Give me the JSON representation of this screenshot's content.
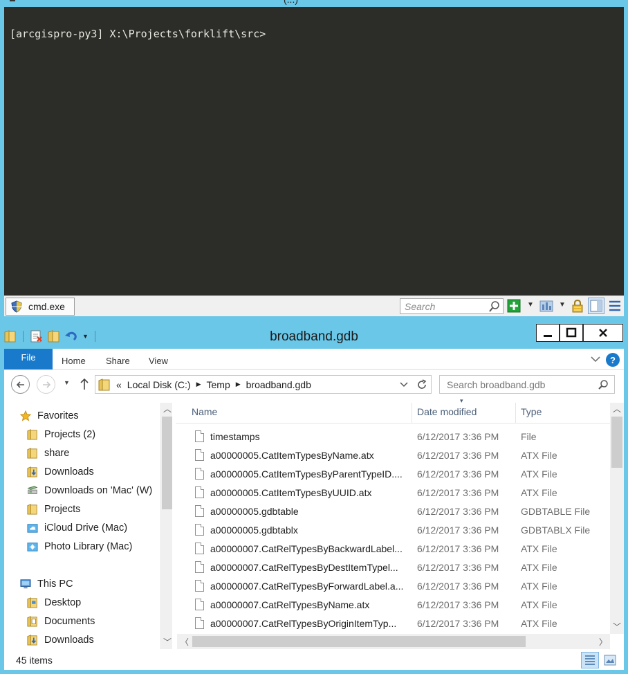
{
  "console": {
    "window_title": "(...)",
    "prompt": "[arcgispro-py3] X:\\Projects\\forklift\\src>",
    "tab_label": "cmd.exe",
    "search_placeholder": "Search"
  },
  "explorer": {
    "title": "broadband.gdb",
    "ribbon_tabs": [
      "File",
      "Home",
      "Share",
      "View"
    ],
    "help_label": "?",
    "address": {
      "overflow": "«",
      "segments": [
        "Local Disk (C:)",
        "Temp",
        "broadband.gdb"
      ]
    },
    "search_placeholder": "Search broadband.gdb",
    "nav": {
      "favorites_label": "Favorites",
      "favorites": [
        "Projects (2)",
        "share",
        "Downloads",
        "Downloads on 'Mac' (W)",
        "Projects",
        "iCloud Drive (Mac)",
        "Photo Library (Mac)"
      ],
      "this_pc_label": "This PC",
      "this_pc": [
        "Desktop",
        "Documents",
        "Downloads"
      ]
    },
    "columns": {
      "name": "Name",
      "date": "Date modified",
      "type": "Type"
    },
    "files": [
      {
        "name": "timestamps",
        "date": "6/12/2017 3:36 PM",
        "type": "File"
      },
      {
        "name": "a00000005.CatItemTypesByName.atx",
        "date": "6/12/2017 3:36 PM",
        "type": "ATX File"
      },
      {
        "name": "a00000005.CatItemTypesByParentTypeID....",
        "date": "6/12/2017 3:36 PM",
        "type": "ATX File"
      },
      {
        "name": "a00000005.CatItemTypesByUUID.atx",
        "date": "6/12/2017 3:36 PM",
        "type": "ATX File"
      },
      {
        "name": "a00000005.gdbtable",
        "date": "6/12/2017 3:36 PM",
        "type": "GDBTABLE File"
      },
      {
        "name": "a00000005.gdbtablx",
        "date": "6/12/2017 3:36 PM",
        "type": "GDBTABLX File"
      },
      {
        "name": "a00000007.CatRelTypesByBackwardLabel...",
        "date": "6/12/2017 3:36 PM",
        "type": "ATX File"
      },
      {
        "name": "a00000007.CatRelTypesByDestItemTypel...",
        "date": "6/12/2017 3:36 PM",
        "type": "ATX File"
      },
      {
        "name": "a00000007.CatRelTypesByForwardLabel.a...",
        "date": "6/12/2017 3:36 PM",
        "type": "ATX File"
      },
      {
        "name": "a00000007.CatRelTypesByName.atx",
        "date": "6/12/2017 3:36 PM",
        "type": "ATX File"
      },
      {
        "name": "a00000007.CatRelTypesByOriginItemTyp...",
        "date": "6/12/2017 3:36 PM",
        "type": "ATX File"
      }
    ],
    "status": "45 items"
  },
  "colors": {
    "frame": "#6bc7e8",
    "console_bg": "#2c2c28",
    "file_tab": "#1979ca",
    "header_text": "#4c607a"
  }
}
